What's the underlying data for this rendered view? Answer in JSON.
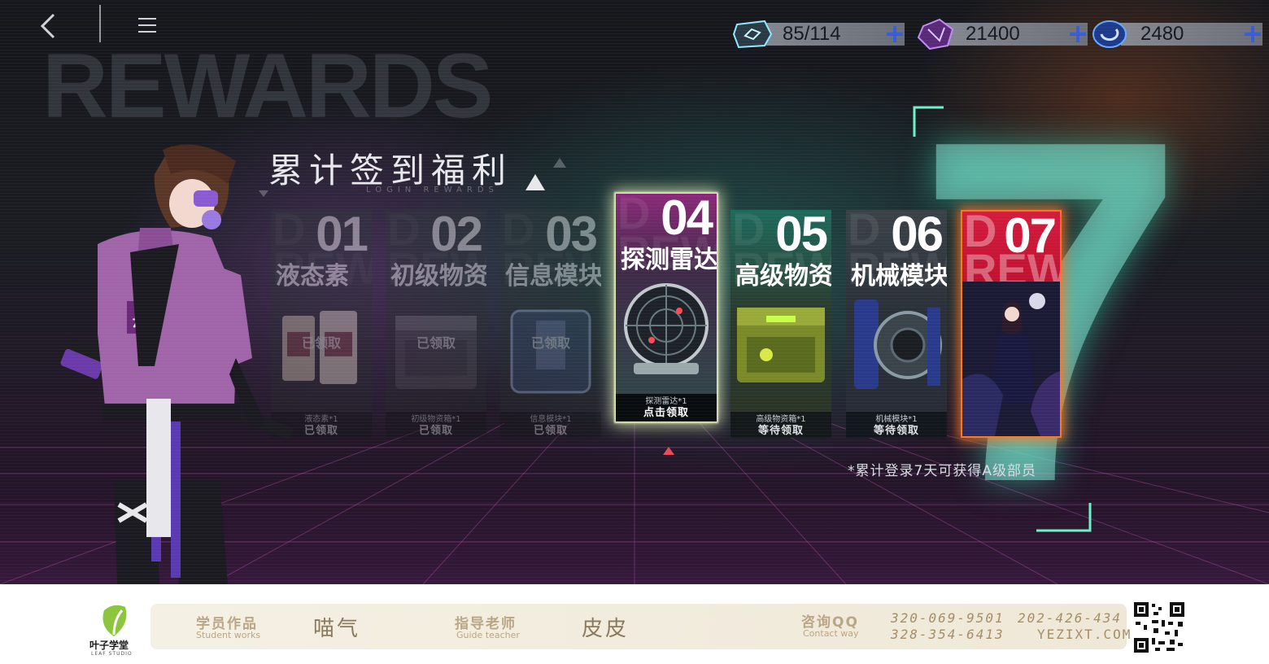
{
  "topbar": {
    "back_icon": "back-chevron-icon",
    "menu_icon": "hamburger-menu-icon",
    "currencies": [
      {
        "icon": "stamina-hex-icon",
        "value": "85/114"
      },
      {
        "icon": "purple-crystal-icon",
        "value": "21400"
      },
      {
        "icon": "blue-gem-icon",
        "value": "2480"
      }
    ]
  },
  "background": {
    "word": "REWARDS",
    "big_number": "7"
  },
  "title": {
    "cn": "累计签到福利",
    "en": "LOGIN REWARDS"
  },
  "cards": [
    {
      "day": "01",
      "name": "液态素",
      "item": "液态素*1",
      "status": "已领取",
      "claimed_mark": "已领取",
      "state": "claimed"
    },
    {
      "day": "02",
      "name": "初级物资",
      "item": "初级物资箱*1",
      "status": "已领取",
      "claimed_mark": "已领取",
      "state": "claimed"
    },
    {
      "day": "03",
      "name": "信息模块",
      "item": "信息模块*1",
      "status": "已领取",
      "claimed_mark": "已领取",
      "state": "claimed"
    },
    {
      "day": "04",
      "name": "探测雷达",
      "item": "探测雷达*1",
      "status": "点击领取",
      "state": "active"
    },
    {
      "day": "05",
      "name": "高级物资",
      "item": "高级物资箱*1",
      "status": "等待领取",
      "state": "pending"
    },
    {
      "day": "06",
      "name": "机械模块",
      "item": "机械模块*1",
      "status": "等待领取",
      "state": "pending"
    },
    {
      "day": "07",
      "name": "",
      "state": "special"
    }
  ],
  "note": "*累计登录7天可获得A级部员",
  "footer": {
    "logo_text": "叶子学堂",
    "logo_sub": "LEAF STUDIO",
    "student_label_cn": "学员作品",
    "student_label_en": "Student works",
    "student_name": "喵气",
    "teacher_label_cn": "指导老师",
    "teacher_label_en": "Guide teacher",
    "teacher_name": "皮皮",
    "contact_label_cn": "咨询QQ",
    "contact_label_en": "Contact way",
    "phone1": "320-069-9501",
    "phone2": "202-426-434",
    "phone3": "328-354-6413",
    "website": "YEZIXT.COM"
  },
  "colors": {
    "accent_green": "#7ff0d0",
    "active_glow": "#f0f4c0",
    "special_red": "#d21c3c",
    "footer_gold": "#b9a684"
  }
}
